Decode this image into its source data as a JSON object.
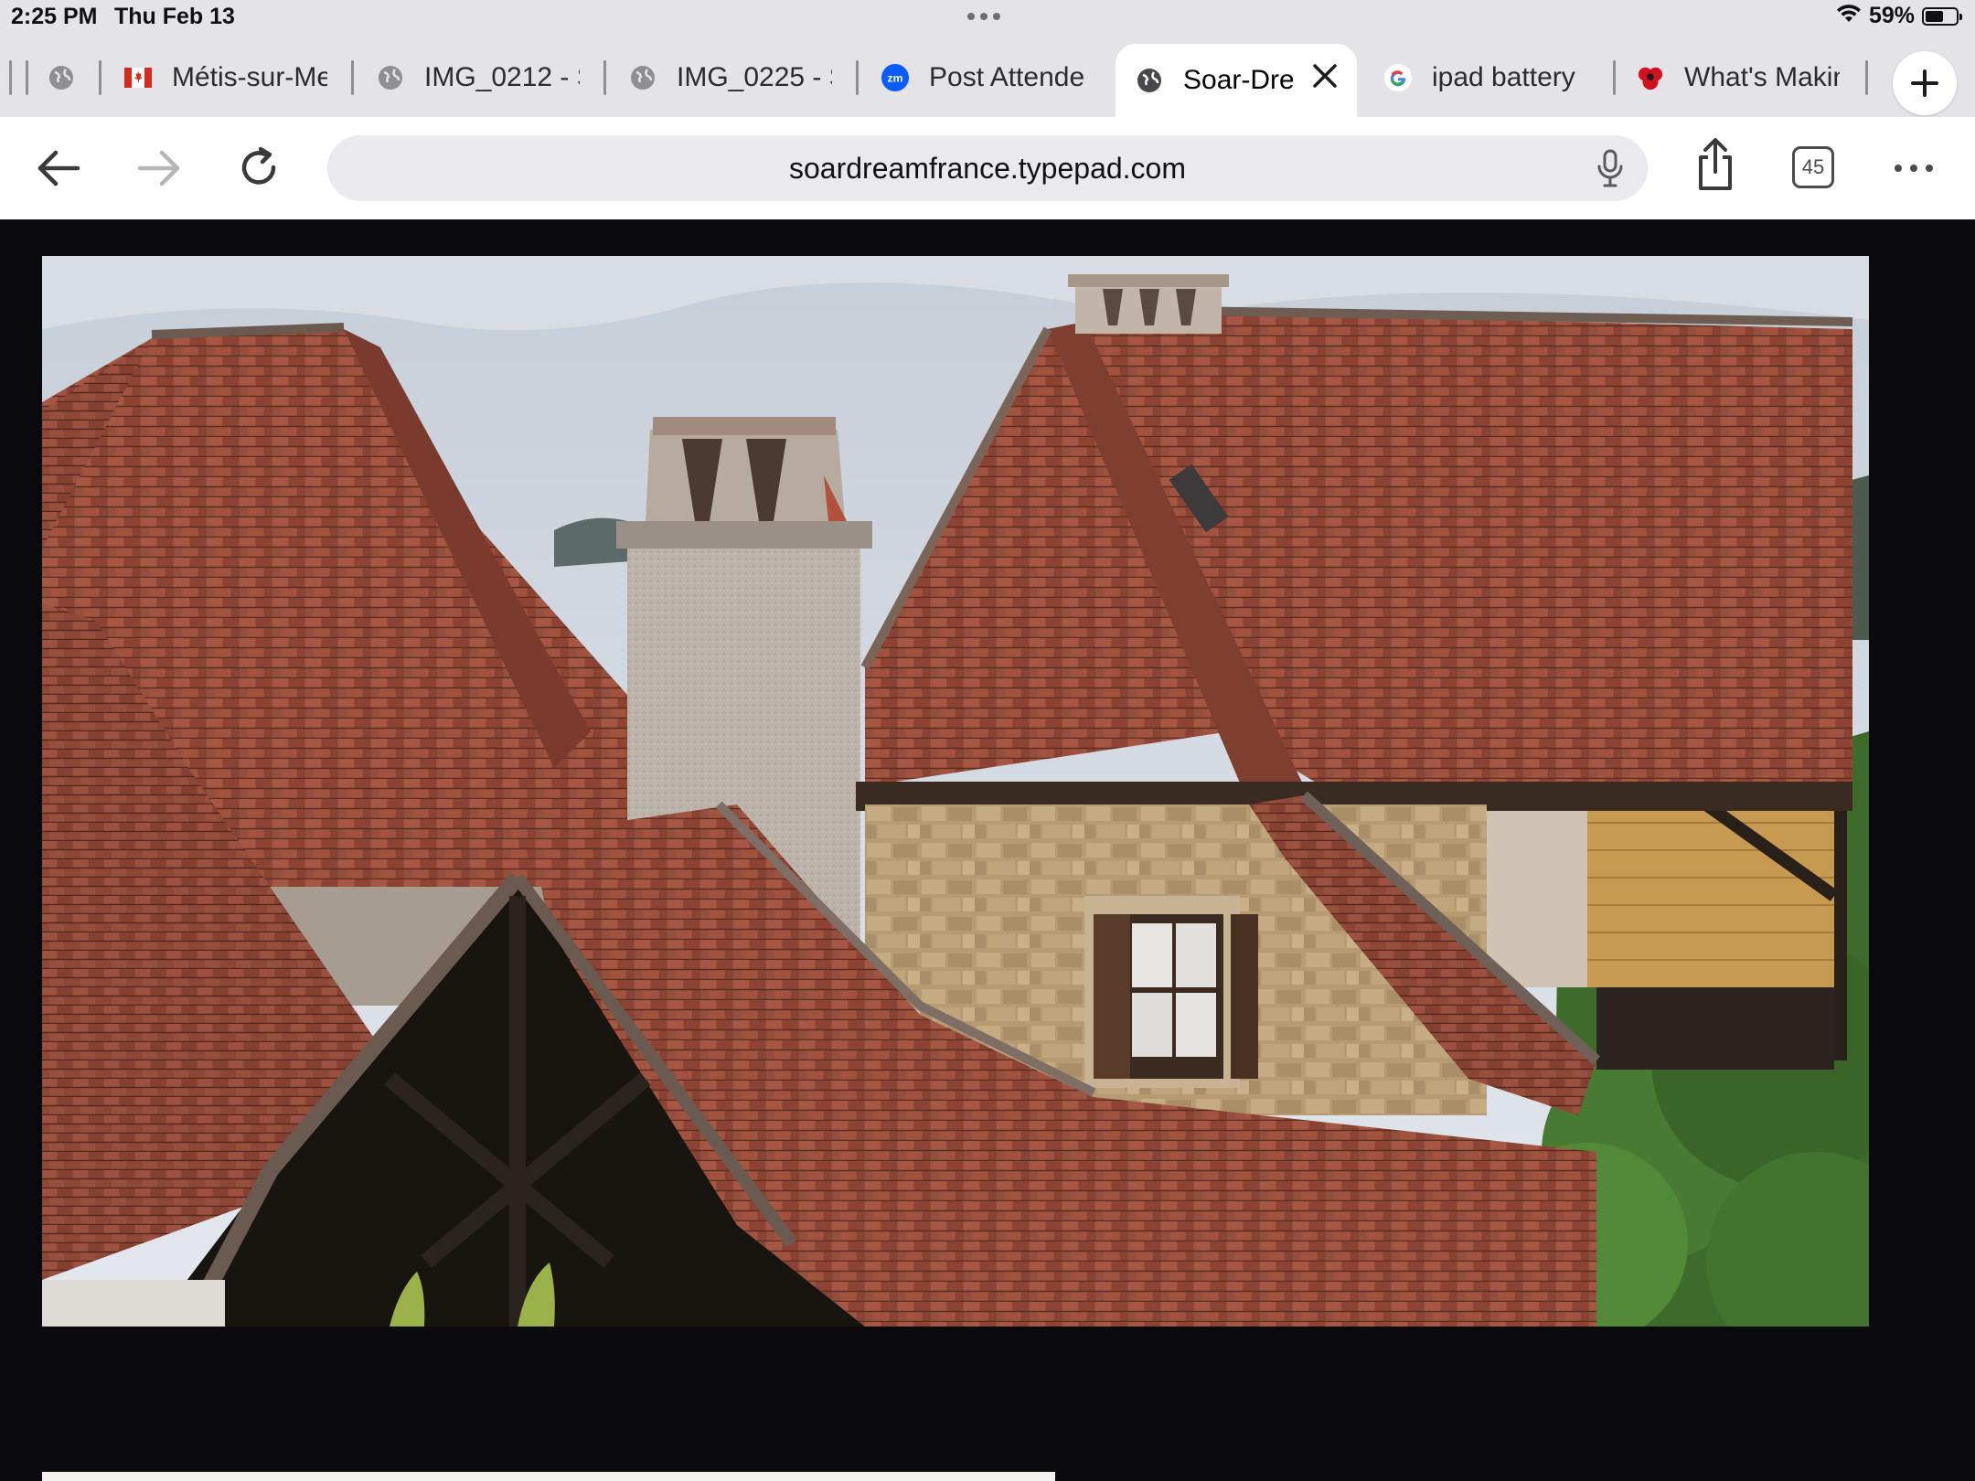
{
  "status_bar": {
    "time": "2:25 PM",
    "date": "Thu Feb 13",
    "battery_percent": "59%",
    "battery_level": 0.59,
    "icons": [
      "wifi-icon",
      "battery-icon"
    ]
  },
  "tabs": [
    {
      "label": "",
      "favicon": "globe-icon",
      "active": false
    },
    {
      "label": "Métis-sur-Me",
      "favicon": "canada-flag-icon",
      "active": false
    },
    {
      "label": "IMG_0212 - S",
      "favicon": "globe-icon",
      "active": false
    },
    {
      "label": "IMG_0225 - S",
      "favicon": "globe-icon",
      "active": false
    },
    {
      "label": "Post Attende",
      "favicon": "zoom-icon",
      "active": false
    },
    {
      "label": "Soar-Dre",
      "favicon": "globe-icon",
      "active": true
    },
    {
      "label": "ipad battery",
      "favicon": "google-icon",
      "active": false
    },
    {
      "label": "What's Makin",
      "favicon": "poppy-icon",
      "active": false
    }
  ],
  "zoom_badge": "zm",
  "toolbar": {
    "url": "soardreamfrance.typepad.com",
    "tab_count": "45",
    "icons": [
      "back-arrow-icon",
      "forward-arrow-icon",
      "reload-icon",
      "microphone-icon",
      "share-icon",
      "tab-overview-icon",
      "more-icon"
    ]
  },
  "page": {
    "photo_description_icon": "photo-rooftops-image"
  },
  "colors": {
    "chrome": "#e3e3e8",
    "toolbar": "#ffffff",
    "page_bg": "#0b0b0d",
    "roof_tile": "#9b4f3c"
  }
}
